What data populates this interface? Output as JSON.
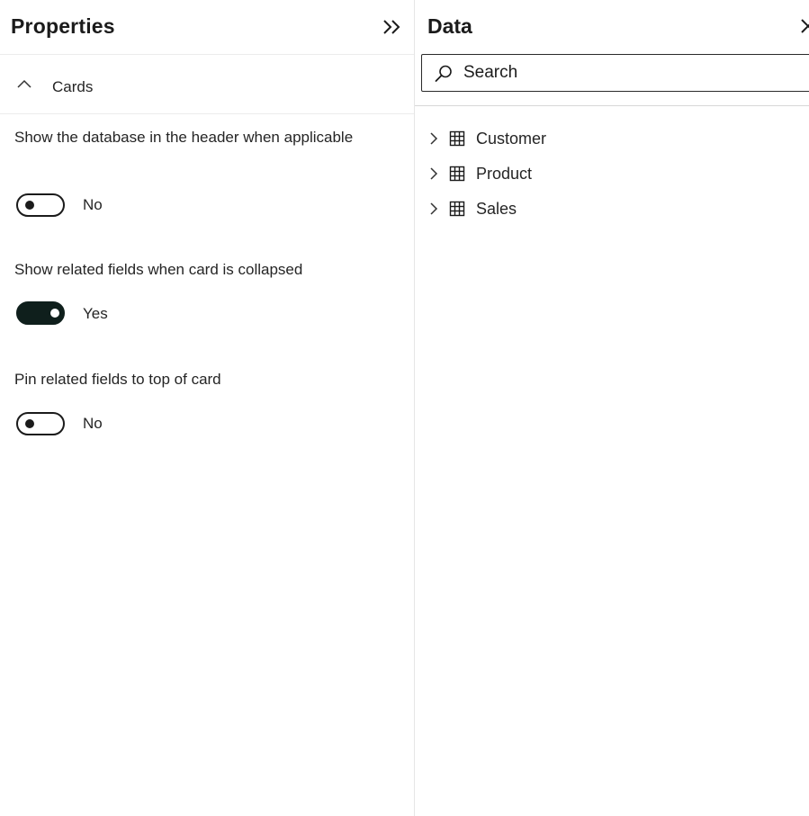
{
  "properties": {
    "title": "Properties",
    "section": {
      "label": "Cards"
    },
    "settings": [
      {
        "label": "Show the database in the header when applicable",
        "state": "No",
        "enabled": false
      },
      {
        "label": "Show related fields when card is collapsed",
        "state": "Yes",
        "enabled": true
      },
      {
        "label": "Pin related fields to top of card",
        "state": "No",
        "enabled": false
      }
    ],
    "icons": {
      "collapse": "double-chevron-right-icon",
      "section": "chevron-up-icon"
    }
  },
  "data_pane": {
    "title": "Data",
    "search": {
      "placeholder": "Search",
      "value": ""
    },
    "tables": [
      {
        "label": "Customer",
        "icon": "table-icon"
      },
      {
        "label": "Product",
        "icon": "table-icon"
      },
      {
        "label": "Sales",
        "icon": "table-icon"
      }
    ],
    "icons": {
      "close": "close-icon",
      "search": "search-icon",
      "expand": "chevron-right-icon"
    }
  },
  "colors": {
    "toggle_on": "#0f1f1c",
    "text": "#252525",
    "border": "#e6e6e6"
  }
}
